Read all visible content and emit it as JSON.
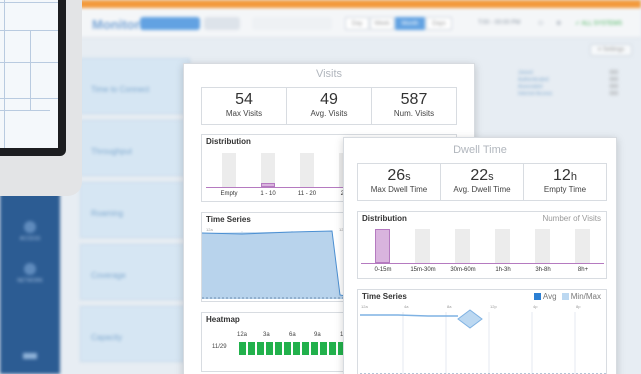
{
  "background": {
    "brand": "Monitor",
    "nav_segments": [
      "Day",
      "Week",
      "Month",
      "Days"
    ],
    "nav_info": "T:00 - 00:00 PM",
    "nav_green": "✓ ALL SYSTEMS",
    "setting_button": "≡ Settings",
    "rows": [
      "Time to Connect",
      "Throughput",
      "Roaming",
      "Coverage",
      "Capacity"
    ],
    "sidebar_items": [
      "ACCESS",
      "NETWORK"
    ],
    "legend_items": [
      {
        "label": "Joined",
        "value": "000"
      },
      {
        "label": "Authenticated",
        "value": "000"
      },
      {
        "label": "Associated",
        "value": "000"
      },
      {
        "label": "Internet Access",
        "value": "000"
      }
    ]
  },
  "visits": {
    "title": "Visits",
    "stats": [
      {
        "value": "54",
        "label": "Max Visits"
      },
      {
        "value": "49",
        "label": "Avg. Visits"
      },
      {
        "value": "587",
        "label": "Num. Visits"
      }
    ],
    "distribution": {
      "title": "Distribution",
      "ticks": [
        "Empty",
        "1 - 10",
        "11 - 20",
        "21"
      ]
    },
    "time_series": {
      "title": "Time Series",
      "axis_labels": [
        "12a",
        "",
        "",
        "12"
      ]
    },
    "heatmap": {
      "title": "Heatmap",
      "hours": [
        "12a",
        "3a",
        "6a",
        "9a",
        "1"
      ],
      "row_label": "11/29"
    }
  },
  "dwell": {
    "title": "Dwell Time",
    "stats": [
      {
        "value": "26",
        "unit": "s",
        "label": "Max Dwell Time"
      },
      {
        "value": "22",
        "unit": "s",
        "label": "Avg. Dwell Time"
      },
      {
        "value": "12",
        "unit": "h",
        "label": "Empty Time"
      }
    ],
    "distribution": {
      "title": "Distribution",
      "right_label": "Number of Visits",
      "ticks": [
        "0-15m",
        "15m-30m",
        "30m-60m",
        "1h-3h",
        "3h-8h",
        "8h+"
      ]
    },
    "time_series": {
      "title": "Time Series",
      "legend": [
        "Avg",
        "Min/Max"
      ],
      "axis_labels": [
        "12a",
        "4a",
        "8a",
        "12p",
        "4p",
        "8p"
      ]
    }
  },
  "colors": {
    "orange": "#f39a3c",
    "bar_highlight": "#d9b4de",
    "area_fill": "#b8d3ec",
    "area_stroke": "#4b8fd2",
    "heatmap_green": "#22b14c",
    "avg_blue": "#2b7fd3",
    "minmax_light": "#bcd8f1"
  }
}
